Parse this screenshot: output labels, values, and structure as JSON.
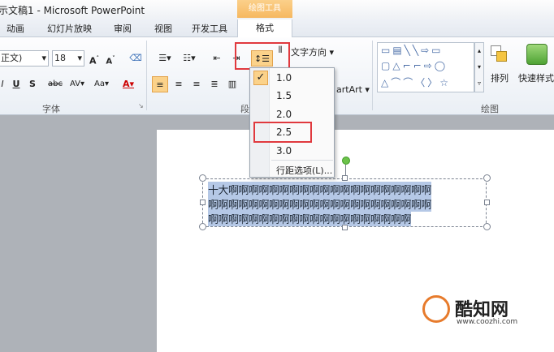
{
  "window": {
    "title": "示文稿1 - Microsoft PowerPoint",
    "context_tab_group": "绘图工具"
  },
  "tabs": [
    "动画",
    "幻灯片放映",
    "审阅",
    "视图",
    "开发工具",
    "格式"
  ],
  "font": {
    "name": "正文)",
    "size": "18",
    "group_label": "字体"
  },
  "paragraph": {
    "text_direction": "文字方向",
    "smartart": "artArt",
    "group_label": "段"
  },
  "drawing": {
    "arrange": "排列",
    "quick_styles": "快速样式",
    "group_label": "绘图"
  },
  "line_spacing_menu": {
    "options": [
      "1.0",
      "1.5",
      "2.0",
      "2.5",
      "3.0"
    ],
    "checked": "1.0",
    "highlighted": "2.5",
    "more": "行距选项(L)..."
  },
  "slide": {
    "lines": [
      "十大啊啊啊啊啊啊啊啊啊啊啊啊啊啊啊啊啊啊啊啊",
      "啊啊啊啊啊啊啊啊啊啊啊啊啊啊啊啊啊啊啊啊啊啊",
      "啊啊啊啊啊啊啊啊啊啊啊啊啊啊啊啊啊啊啊啊"
    ]
  },
  "watermark": {
    "brand": "酷知网",
    "url": "www.coozhi.com"
  },
  "colors": {
    "accent_red": "#e0393e",
    "selected": "#fbd28a"
  }
}
